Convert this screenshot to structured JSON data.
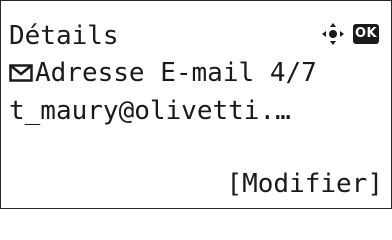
{
  "screen": {
    "title": "Détails",
    "ok_label": "OK",
    "field": {
      "icon": "envelope-icon",
      "label": "Adresse E-mail",
      "counter": "4/7"
    },
    "value": "t_maury@olivetti.…",
    "softkey_label": "[Modifier]"
  },
  "icons": {
    "navigation": "dpad-navigation-icon",
    "ok": "ok-key-icon",
    "field": "envelope-icon"
  },
  "colors": {
    "text": "#1a1a1a",
    "background": "#ffffff",
    "border": "#2a2a2a"
  }
}
